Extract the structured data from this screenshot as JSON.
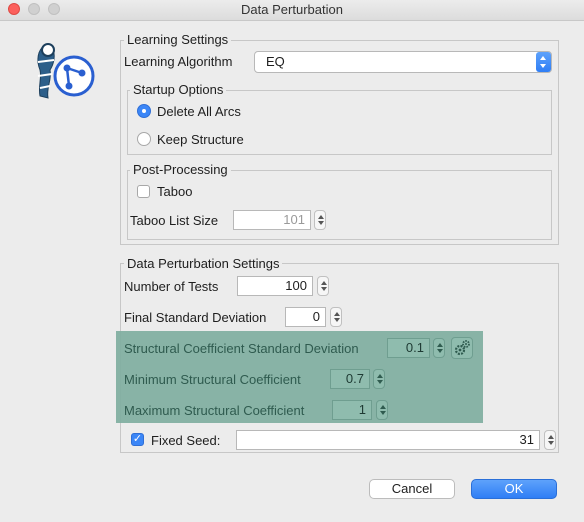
{
  "window": {
    "title": "Data Perturbation"
  },
  "learning_settings": {
    "legend": "Learning Settings",
    "algorithm_label": "Learning Algorithm",
    "algorithm_value": "EQ",
    "startup": {
      "legend": "Startup Options",
      "options": [
        {
          "label": "Delete All Arcs",
          "selected": true
        },
        {
          "label": "Keep Structure",
          "selected": false
        }
      ]
    },
    "post_processing": {
      "legend": "Post-Processing",
      "taboo_label": "Taboo",
      "taboo_checked": false,
      "taboo_list_size_label": "Taboo List Size",
      "taboo_list_size_value": "101"
    }
  },
  "perturbation": {
    "legend": "Data Perturbation Settings",
    "number_of_tests_label": "Number of Tests",
    "number_of_tests_value": "100",
    "final_sd_label": "Final Standard Deviation",
    "final_sd_value": "0",
    "structural_sd_label": "Structural Coefficient Standard Deviation",
    "structural_sd_value": "0.1",
    "min_structural_label": "Minimum Structural Coefficient",
    "min_structural_value": "0.7",
    "max_structural_label": "Maximum Structural Coefficient",
    "max_structural_value": "1",
    "fixed_seed_label": "Fixed Seed:",
    "fixed_seed_checked": true,
    "fixed_seed_value": "31"
  },
  "buttons": {
    "cancel": "Cancel",
    "ok": "OK"
  },
  "colors": {
    "accent": "#3b86f7",
    "highlight": "#7fae9f",
    "close": "#fc605c"
  },
  "icons": {
    "app": "network-person-icon",
    "settings": "gears-icon"
  }
}
